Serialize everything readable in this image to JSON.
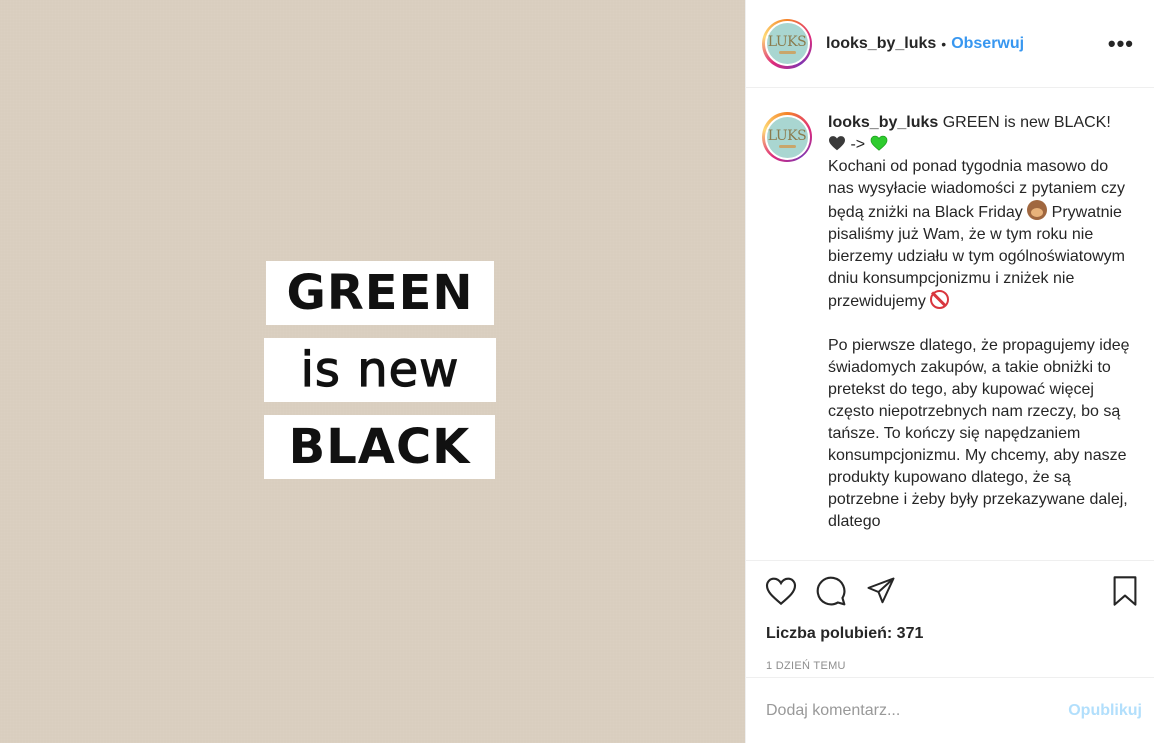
{
  "image": {
    "line1": "GREEN",
    "line2": "is new",
    "line3": "BLACK"
  },
  "header": {
    "avatar_logo": "LUKS",
    "username": "looks_by_luks",
    "separator": "•",
    "follow_label": "Obserwuj",
    "more_label": "•••"
  },
  "caption": {
    "username": "looks_by_luks",
    "first_line": "GREEN is new BLACK!",
    "arrow": "->",
    "para1_a": "Kochani od ponad tygodnia masowo do nas wysyłacie wiadomości z pytaniem czy będą zniżki na Black Friday",
    "para1_b": "Prywatnie pisaliśmy już Wam, że w tym roku nie bierzemy udziału w tym ogólnoświatowym dniu konsumpcjonizmu i zniżek nie przewidujemy",
    "para2": "Po pierwsze dlatego, że propagujemy ideę świadomych zakupów, a takie obniżki to pretekst do tego, aby kupować więcej często niepotrzebnych nam rzeczy, bo są tańsze. To kończy się napędzaniem konsumpcjonizmu. My chcemy, aby nasze produkty kupowano dlatego, że są potrzebne i żeby były przekazywane dalej, dlatego"
  },
  "likes": {
    "text": "Liczba polubień: 371"
  },
  "timestamp": "1 DZIEŃ TEMU",
  "comment_box": {
    "placeholder": "Dodaj komentarz...",
    "post_label": "Opublikuj"
  },
  "colors": {
    "image_bg": "#d9cebf",
    "link": "#3897f0",
    "post_disabled": "#b2dffc"
  }
}
